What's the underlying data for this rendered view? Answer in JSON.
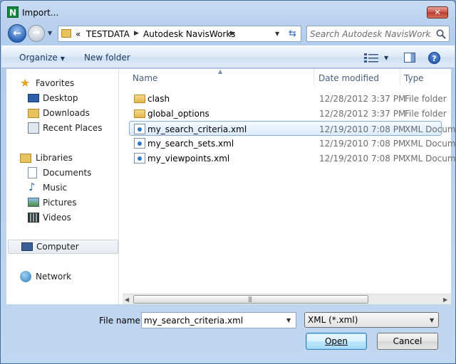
{
  "window": {
    "title": "Import..."
  },
  "navigation": {
    "breadcrumbs": [
      "TESTDATA",
      "Autodesk NavisWorks"
    ],
    "overflow": "«"
  },
  "search": {
    "placeholder": "Search Autodesk NavisWorks"
  },
  "toolbar": {
    "organize_label": "Organize",
    "new_folder_label": "New folder"
  },
  "sidebar": {
    "groups": [
      {
        "label": "Favorites",
        "items": [
          "Desktop",
          "Downloads",
          "Recent Places"
        ]
      },
      {
        "label": "Libraries",
        "items": [
          "Documents",
          "Music",
          "Pictures",
          "Videos"
        ]
      },
      {
        "label": "Computer",
        "items": []
      },
      {
        "label": "Network",
        "items": []
      }
    ]
  },
  "file_list": {
    "columns": [
      "Name",
      "Date modified",
      "Type"
    ],
    "rows": [
      {
        "name": "clash",
        "date": "12/28/2012 3:37 PM",
        "type": "File folder",
        "kind": "folder"
      },
      {
        "name": "global_options",
        "date": "12/28/2012 3:37 PM",
        "type": "File folder",
        "kind": "folder"
      },
      {
        "name": "my_search_criteria.xml",
        "date": "12/19/2010 7:08 PM",
        "type": "XML Docum",
        "kind": "xml",
        "selected": true
      },
      {
        "name": "my_search_sets.xml",
        "date": "12/19/2010 7:08 PM",
        "type": "XML Docum",
        "kind": "xml"
      },
      {
        "name": "my_viewpoints.xml",
        "date": "12/19/2010 7:08 PM",
        "type": "XML Docum",
        "kind": "xml"
      }
    ]
  },
  "footer": {
    "file_name_label": "File name:",
    "file_name_value": "my_search_criteria.xml",
    "file_type_value": "XML (*.xml)",
    "open_label": "Open",
    "cancel_label": "Cancel"
  },
  "colors": {
    "accent": "#3c7fb1",
    "selection": "#dcebfc"
  }
}
